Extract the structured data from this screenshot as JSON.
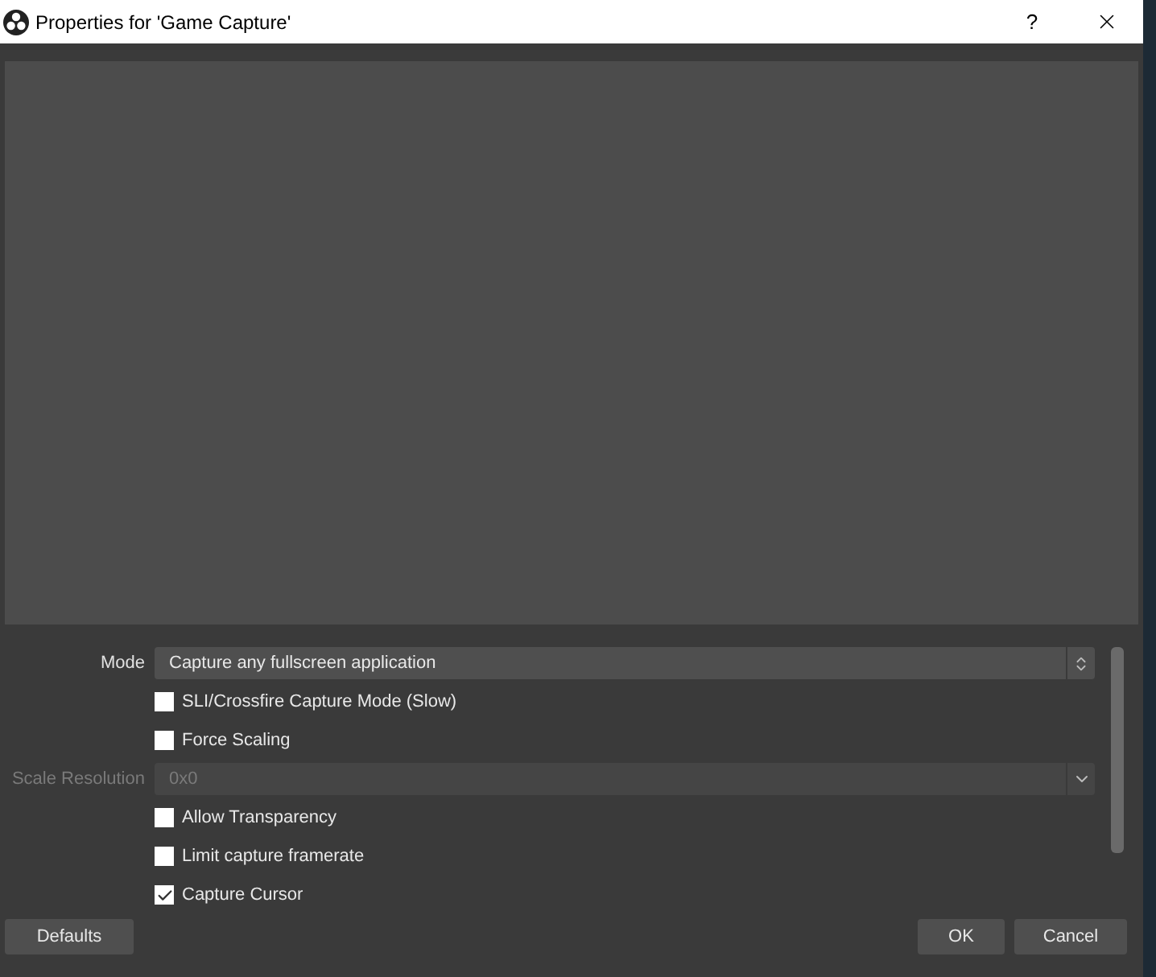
{
  "window": {
    "title": "Properties for 'Game Capture'",
    "help": "?"
  },
  "properties": [
    {
      "kind": "dropdown",
      "label": "Mode",
      "value": "Capture any fullscreen application",
      "disabled": false
    },
    {
      "kind": "checkbox",
      "label": "SLI/Crossfire Capture Mode (Slow)",
      "checked": false
    },
    {
      "kind": "checkbox",
      "label": "Force Scaling",
      "checked": false
    },
    {
      "kind": "dropdown",
      "label": "Scale Resolution",
      "value": "0x0",
      "disabled": true
    },
    {
      "kind": "checkbox",
      "label": "Allow Transparency",
      "checked": false
    },
    {
      "kind": "checkbox",
      "label": "Limit capture framerate",
      "checked": false
    },
    {
      "kind": "checkbox",
      "label": "Capture Cursor",
      "checked": true
    }
  ],
  "buttons": {
    "defaults": "Defaults",
    "ok": "OK",
    "cancel": "Cancel"
  }
}
